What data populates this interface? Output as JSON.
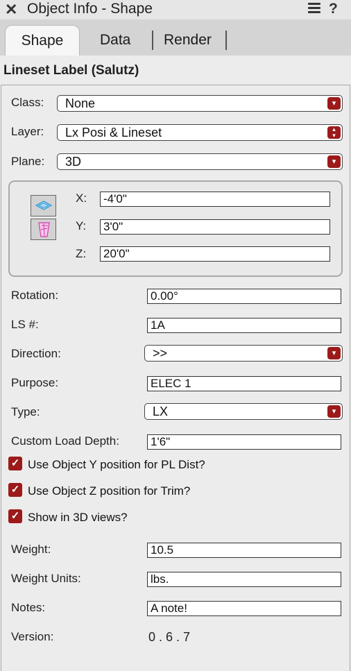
{
  "window": {
    "title": "Object Info - Shape",
    "close_glyph": "✕",
    "menu_icon": "hamburger-icon",
    "help_glyph": "?"
  },
  "tabs": [
    {
      "label": "Shape",
      "active": true
    },
    {
      "label": "Data",
      "active": false
    },
    {
      "label": "Render",
      "active": false
    }
  ],
  "object_name": "Lineset Label (Salutz)",
  "class": {
    "label": "Class:",
    "value": "None"
  },
  "layer": {
    "label": "Layer:",
    "value": "Lx Posi & Lineset"
  },
  "plane": {
    "label": "Plane:",
    "value": "3D"
  },
  "coords": {
    "x_label": "X:",
    "x_value": "-4'0\"",
    "y_label": "Y:",
    "y_value": "3'0\"",
    "z_label": "Z:",
    "z_value": "20'0\""
  },
  "params": {
    "rotation": {
      "label": "Rotation:",
      "value": "0.00°"
    },
    "ls_num": {
      "label": "LS #:",
      "value": "1A"
    },
    "direction": {
      "label": "Direction:",
      "value": ">>"
    },
    "purpose": {
      "label": "Purpose:",
      "value": "ELEC 1"
    },
    "type": {
      "label": "Type:",
      "value": "LX"
    },
    "custom_load_depth": {
      "label": "Custom Load Depth:",
      "value": "1'6\""
    },
    "use_y": {
      "label": "Use Object Y position for PL Dist?",
      "checked": true
    },
    "use_z": {
      "label": "Use Object Z position for Trim?",
      "checked": true
    },
    "show_3d": {
      "label": "Show in 3D views?",
      "checked": true
    },
    "weight": {
      "label": "Weight:",
      "value": "10.5"
    },
    "weight_units": {
      "label": "Weight Units:",
      "value": "lbs."
    },
    "notes": {
      "label": "Notes:",
      "value": "A note!"
    },
    "version": {
      "label": "Version:",
      "value": "0 . 6 . 7"
    }
  },
  "colors": {
    "accent": "#9c1a1a",
    "panel_bg": "#ececec",
    "tab_bg": "#d4d4d4"
  }
}
